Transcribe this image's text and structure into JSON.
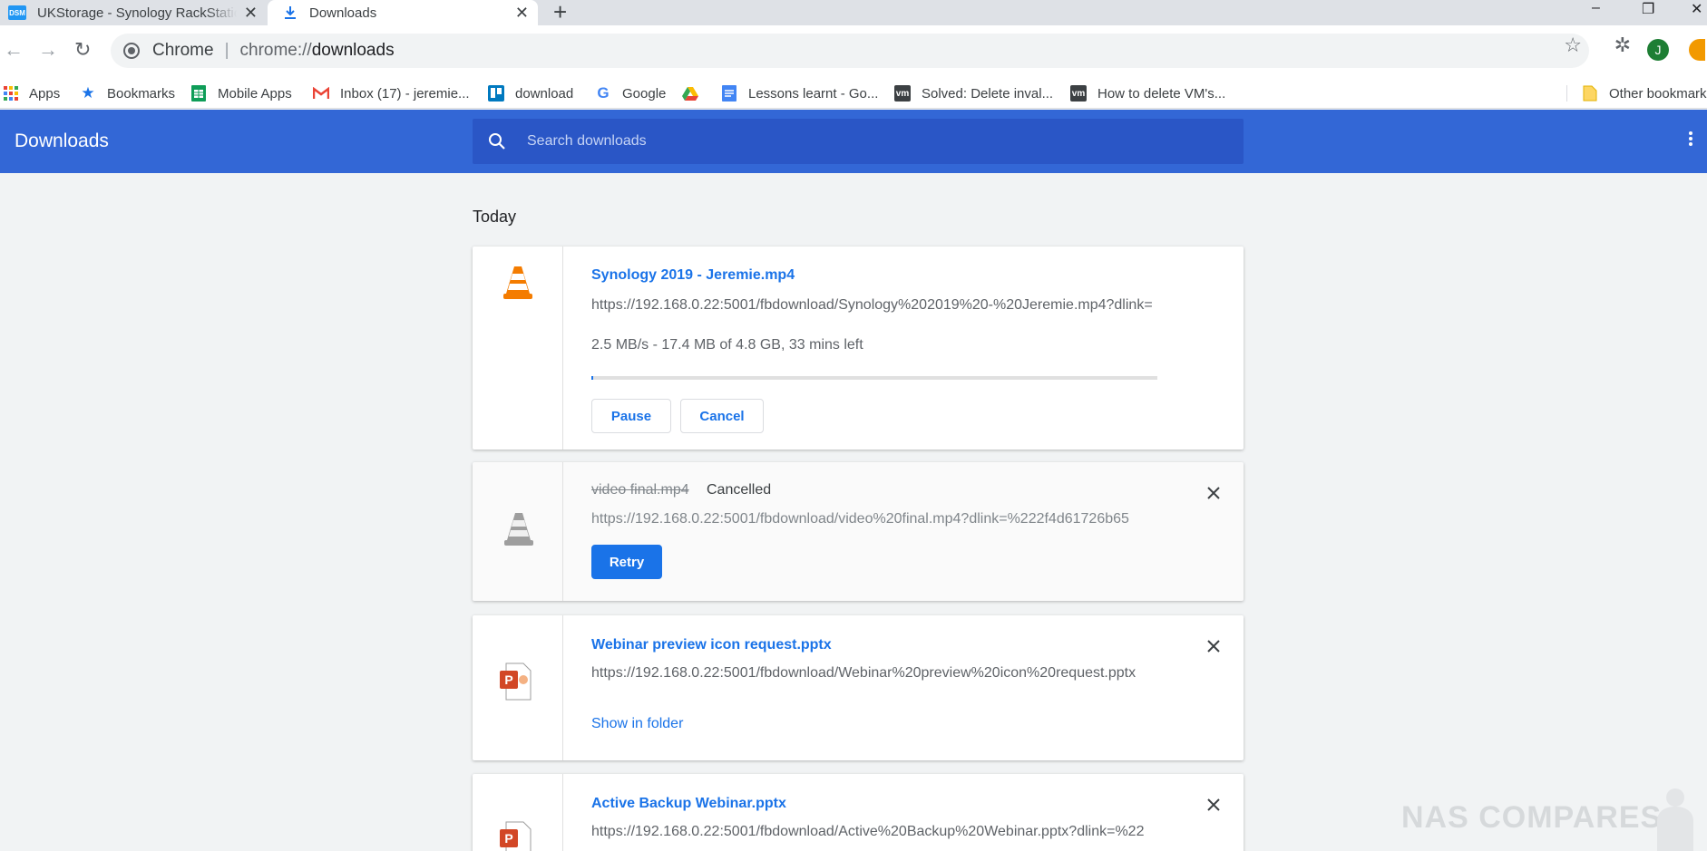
{
  "browser": {
    "tabs": [
      {
        "label": "UKStorage - Synology RackStatio",
        "favicon": "DSM",
        "active": false
      },
      {
        "label": "Downloads",
        "favicon": "download-icon",
        "active": true
      }
    ],
    "new_tab": "+",
    "window": {
      "minimize": "–",
      "maximize": "❐",
      "close": "✕"
    },
    "omnibox": {
      "site_label": "Chrome",
      "separator": "|",
      "scheme": "chrome://",
      "host": "downloads"
    },
    "avatar_letter": "J"
  },
  "bookmarks": [
    {
      "label": "Apps",
      "icon": "apps-grid-icon"
    },
    {
      "label": "Bookmarks",
      "icon": "star-icon"
    },
    {
      "label": "Mobile Apps",
      "icon": "sheets-icon"
    },
    {
      "label": "Inbox (17) - jeremie...",
      "icon": "gmail-icon"
    },
    {
      "label": "download",
      "icon": "trello-icon"
    },
    {
      "label": "Google",
      "icon": "google-icon"
    },
    {
      "label": "",
      "icon": "drive-icon"
    },
    {
      "label": "Lessons learnt - Go...",
      "icon": "docs-icon"
    },
    {
      "label": "Solved: Delete inval...",
      "icon": "vmware-icon"
    },
    {
      "label": "How to delete VM's...",
      "icon": "vmware-icon"
    },
    {
      "label": "Other bookmarks",
      "icon": "folder-icon"
    }
  ],
  "header": {
    "title": "Downloads",
    "search_placeholder": "Search downloads"
  },
  "content": {
    "section": "Today",
    "items": [
      {
        "filename": "Synology 2019 - Jeremie.mp4",
        "url": "https://192.168.0.22:5001/fbdownload/Synology%202019%20-%20Jeremie.mp4?dlink=",
        "progress_text": "2.5 MB/s - 17.4 MB of 4.8 GB, 33 mins left",
        "progress": 0.0035,
        "pause_label": "Pause",
        "cancel_label": "Cancel",
        "icon": "vlc-cone-icon"
      },
      {
        "filename": "video final.mp4",
        "status": "Cancelled",
        "url": "https://192.168.0.22:5001/fbdownload/video%20final.mp4?dlink=%222f4d61726b65",
        "retry_label": "Retry",
        "icon": "vlc-cone-grey-icon"
      },
      {
        "filename": "Webinar preview icon request.pptx",
        "url": "https://192.168.0.22:5001/fbdownload/Webinar%20preview%20icon%20request.pptx",
        "action_label": "Show in folder",
        "icon": "powerpoint-file-icon"
      },
      {
        "filename": "Active Backup Webinar.pptx",
        "url": "https://192.168.0.22:5001/fbdownload/Active%20Backup%20Webinar.pptx?dlink=%22",
        "icon": "powerpoint-file-icon"
      }
    ]
  },
  "watermark": "NAS COMPARES",
  "colors": {
    "header_blue": "#3367d6",
    "search_blue": "#2a56c6",
    "link_blue": "#1a73e8",
    "page_bg": "#f1f3f4"
  }
}
